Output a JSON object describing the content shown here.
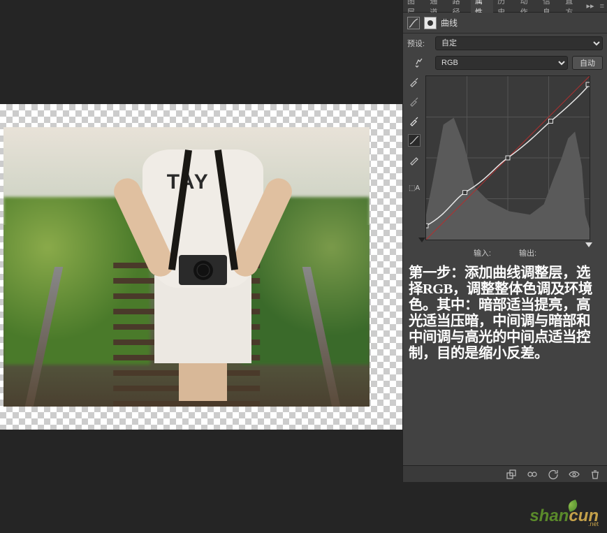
{
  "tabs": {
    "t0": "图层",
    "t1": "通道",
    "t2": "路径",
    "t3": "属性",
    "t4": "历史",
    "t5": "动作",
    "t6": "信息",
    "t7": "直方"
  },
  "panel_title": "曲线",
  "preset": {
    "label": "预设:",
    "value": "自定"
  },
  "channel": {
    "value": "RGB",
    "auto_label": "自动"
  },
  "io": {
    "input_label": "输入:",
    "output_label": "输出:"
  },
  "instructions": "第一步：添加曲线调整层，选择RGB，调整整体色调及环境色。其中：暗部适当提亮，高光适当压暗，中间调与暗部和中间调与高光的中间点适当控制，目的是缩小反差。",
  "photo_text": "TAY",
  "watermark": {
    "p1": "shan",
    "p2": "cun",
    "sub": ".net"
  },
  "chart_data": {
    "type": "curve",
    "title": "曲线 (Curves)",
    "channel": "RGB",
    "range": [
      0,
      255
    ],
    "baseline": [
      [
        0,
        0
      ],
      [
        255,
        255
      ]
    ],
    "points": [
      {
        "input": 0,
        "output": 22
      },
      {
        "input": 60,
        "output": 74
      },
      {
        "input": 128,
        "output": 128
      },
      {
        "input": 195,
        "output": 185
      },
      {
        "input": 255,
        "output": 242
      }
    ]
  }
}
